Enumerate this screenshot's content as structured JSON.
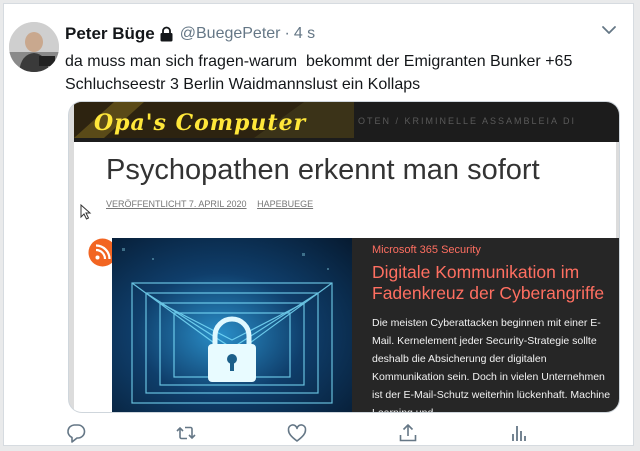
{
  "tweet": {
    "author_name": "Peter Büge",
    "handle": "@BuegePeter",
    "separator": "·",
    "time": "4 s",
    "text": "da muss man sich fragen-warum  bekommt der Emigranten Bunker +65 Schluchseestr 3 Berlin Waidmannslust ein Kollaps"
  },
  "embedded_page": {
    "site_logo": "Opa's Computer",
    "banner_tagline": "OTEN / KRIMINELLE ASSAMBLEIA DI",
    "post_title": "Psychopathen erkennt man sofort",
    "meta_date": "VERÖFFENTLICHT 7. APRIL 2020",
    "meta_author": "HAPEBUEGE",
    "share_icons": [
      "rss-icon",
      "email-icon",
      "facebook-icon",
      "twitter-icon"
    ],
    "article": {
      "category": "Microsoft 365 Security",
      "headline": "Digitale Kommunikation im Fadenkreuz der Cyberangriffe",
      "body": "Die meisten Cyberattacken beginnen mit einer E-Mail. Kernelement jeder Security-Strategie sollte deshalb die Absicherung der digitalen Kommunikation sein. Doch in vielen Unternehmen ist der E-Mail-Schutz weiterhin lückenhaft. Machine Learning und"
    }
  },
  "colors": {
    "text_primary": "#14171a",
    "text_secondary": "#657786",
    "accent_red": "#ff6f61",
    "rss": "#f26522",
    "facebook": "#3b5998",
    "twitter": "#2e83c5",
    "icon_blue": "#1da1f2"
  },
  "action_icons": [
    "reply-icon",
    "retweet-icon",
    "like-icon",
    "share-icon",
    "analytics-icon"
  ]
}
